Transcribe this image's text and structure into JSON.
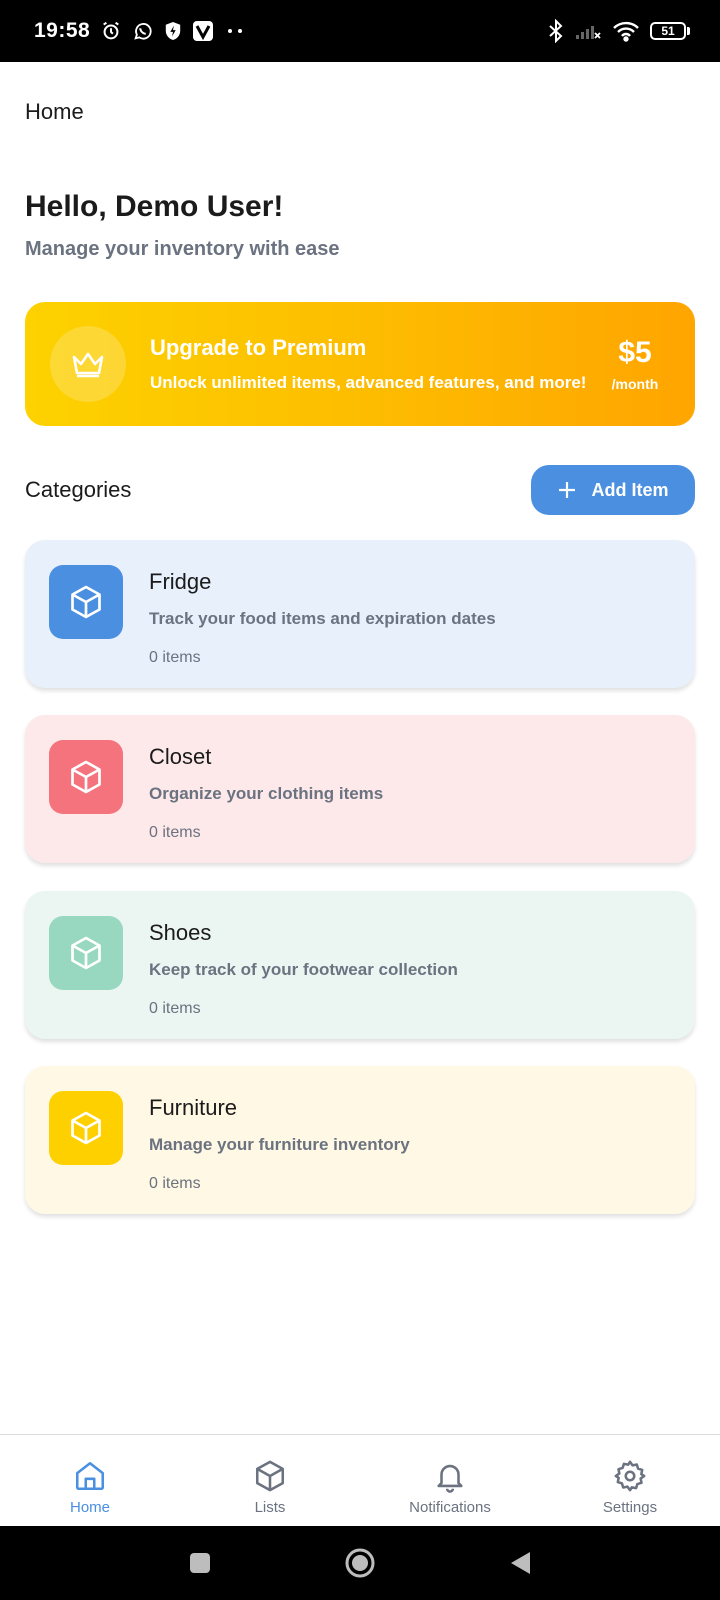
{
  "status_bar": {
    "time": "19:58",
    "battery": "51",
    "icons": [
      "alarm-icon",
      "whatsapp-icon",
      "shield-icon",
      "v-app-icon",
      "bluetooth-icon",
      "signal-icon",
      "wifi-icon"
    ]
  },
  "app_bar": {
    "title": "Home"
  },
  "greeting": "Hello, Demo User!",
  "subtitle": "Manage your inventory with ease",
  "premium": {
    "title": "Upgrade to Premium",
    "description": "Unlock unlimited items, advanced features, and more!",
    "price": "$5",
    "period": "/month",
    "colors": {
      "start": "#fdd200",
      "end": "#ffa500"
    }
  },
  "categories_header": {
    "title": "Categories",
    "add_button": "Add Item"
  },
  "categories": [
    {
      "title": "Fridge",
      "description": "Track your food items and expiration dates",
      "count": "0 items",
      "bg": "#e8f0fc",
      "accent": "#4a8fe0"
    },
    {
      "title": "Closet",
      "description": "Organize your clothing items",
      "count": "0 items",
      "bg": "#fde9ea",
      "accent": "#f4737d"
    },
    {
      "title": "Shoes",
      "description": "Keep track of your footwear collection",
      "count": "0 items",
      "bg": "#ebf5f1",
      "accent": "#98d8c0"
    },
    {
      "title": "Furniture",
      "description": "Manage your furniture inventory",
      "count": "0 items",
      "bg": "#fff8e4",
      "accent": "#ffd000"
    }
  ],
  "bottom_nav": [
    {
      "label": "Home",
      "icon": "home-icon",
      "active": true
    },
    {
      "label": "Lists",
      "icon": "box-icon",
      "active": false
    },
    {
      "label": "Notifications",
      "icon": "bell-icon",
      "active": false
    },
    {
      "label": "Settings",
      "icon": "gear-icon",
      "active": false
    }
  ],
  "colors": {
    "accent": "#4a8fe0",
    "muted_text": "#6b7280"
  }
}
